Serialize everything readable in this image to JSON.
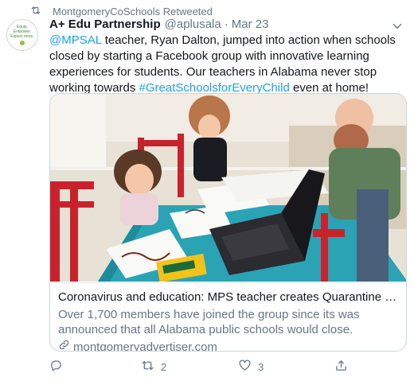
{
  "retweet_context": {
    "text": "MontgomeryCoSchools Retweeted",
    "icon": "retweet-icon"
  },
  "avatar": {
    "lines": "Equip. Empower. Expect more."
  },
  "tweet": {
    "author_name": "A+ Edu Partnership",
    "author_handle": "@aplusala",
    "separator": "·",
    "time": "Mar 23",
    "text_mention": "@MPSAL",
    "text_body_1": " teacher, Ryan Dalton, jumped into action when schools closed by starting a Facebook group with innovative learning experiences for students. Our teachers in Alabama never stop working towards ",
    "text_hashtag": "#GreatSchoolsforEveryChild",
    "text_body_2": " even at home!"
  },
  "card": {
    "image": "photo of a father and two young girls drawing at a table with a laptop",
    "title": "Coronavirus and education: MPS teacher creates Quarantine Learning gr…",
    "description": "Over 1,700 members have joined the group since its was announced that all Alabama public schools would close.",
    "domain": "montgomeryadvertiser.com",
    "domain_icon": "link-icon"
  },
  "actions": {
    "reply_count": "",
    "retweet_count": "2",
    "like_count": "3",
    "share_count": ""
  },
  "colors": {
    "link": "#1da1f2",
    "secondary_text": "#657786",
    "border": "#ccd6dd"
  }
}
